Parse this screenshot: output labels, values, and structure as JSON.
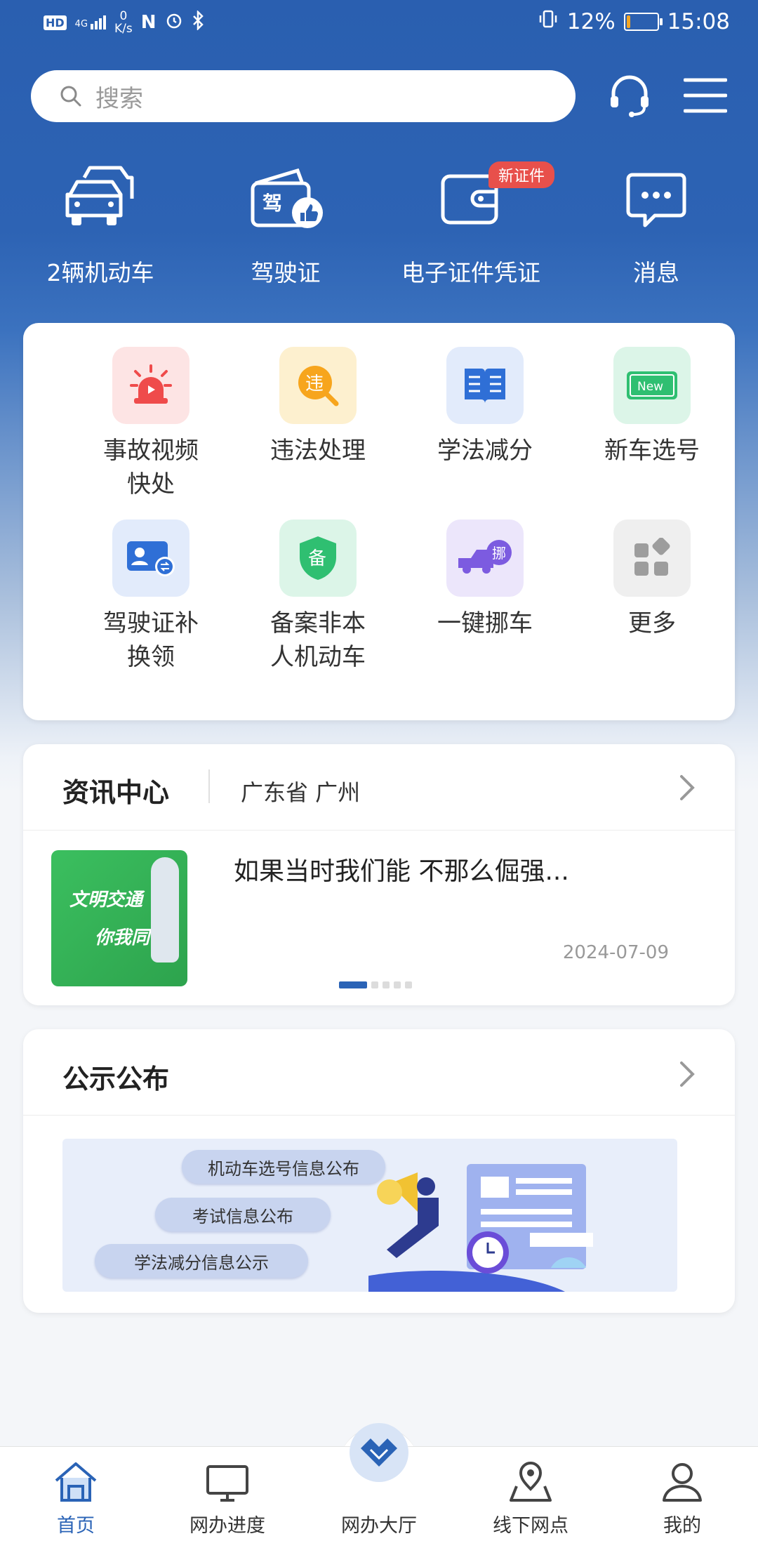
{
  "status_bar": {
    "hd": "HD",
    "network": "4G",
    "speed_value": "0",
    "speed_unit": "K/s",
    "battery_percent": "12%",
    "battery_level": 0.12,
    "time": "15:08"
  },
  "search": {
    "placeholder": "搜索"
  },
  "quick_entries": [
    {
      "label": "2辆机动车",
      "icon": "car-icon"
    },
    {
      "label": "驾驶证",
      "icon": "license-icon"
    },
    {
      "label": "电子证件凭证",
      "icon": "wallet-icon",
      "badge": "新证件"
    },
    {
      "label": "消息",
      "icon": "message-icon"
    }
  ],
  "services": [
    {
      "label": "事故视频快处",
      "lines": [
        "事故视频",
        "快处"
      ],
      "icon": "alarm-light-icon"
    },
    {
      "label": "违法处理",
      "lines": [
        "违法处理"
      ],
      "icon": "violation-icon",
      "glyph": "违"
    },
    {
      "label": "学法减分",
      "lines": [
        "学法减分"
      ],
      "icon": "book-icon"
    },
    {
      "label": "新车选号",
      "lines": [
        "新车选号"
      ],
      "icon": "new-plate-icon",
      "glyph": "New"
    },
    {
      "label": "驾驶证补换领",
      "lines": [
        "驾驶证补",
        "换领"
      ],
      "icon": "id-card-swap-icon"
    },
    {
      "label": "备案非本人机动车",
      "lines": [
        "备案非本",
        "人机动车"
      ],
      "icon": "shield-icon",
      "glyph": "备"
    },
    {
      "label": "一键挪车",
      "lines": [
        "一键挪车"
      ],
      "icon": "tow-truck-icon",
      "glyph": "挪"
    },
    {
      "label": "更多",
      "lines": [
        "更多"
      ],
      "icon": "grid-more-icon"
    }
  ],
  "news": {
    "title": "资讯中心",
    "location": "广东省 广州",
    "headline": "如果当时我们能 不那么倔强...",
    "date": "2024-07-09",
    "thumb_text_1": "文明交通",
    "thumb_text_2": "你我同行",
    "slides_total": 5,
    "slide_active": 1
  },
  "notice": {
    "title": "公示公布",
    "items": [
      "机动车选号信息公布",
      "考试信息公布",
      "学法减分信息公示"
    ]
  },
  "tabs": [
    {
      "label": "首页",
      "icon": "home-icon",
      "active": true
    },
    {
      "label": "网办进度",
      "icon": "monitor-icon",
      "active": false
    },
    {
      "label": "网办大厅",
      "icon": "handshake-icon",
      "active": false
    },
    {
      "label": "线下网点",
      "icon": "map-pin-icon",
      "active": false
    },
    {
      "label": "我的",
      "icon": "user-icon",
      "active": false
    }
  ],
  "colors": {
    "primary": "#2a5fb0",
    "active_tab": "#2a63b6",
    "badge": "#e8504b",
    "battery_low": "#f5a623"
  }
}
